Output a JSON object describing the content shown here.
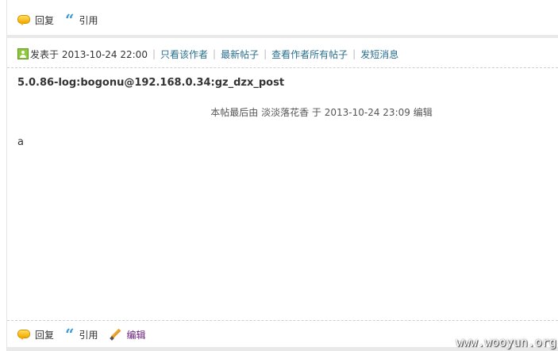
{
  "top_actions": {
    "reply": "回复",
    "quote": "引用"
  },
  "post": {
    "posted_at": "发表于 2013-10-24 22:00",
    "links": [
      "只看该作者",
      "最新帖子",
      "查看作者所有帖子",
      "发短消息"
    ],
    "title": "5.0.86-log:bogonu@192.168.0.34:gz_dzx_post",
    "edit_note": "本帖最后由 淡淡落花香 于 2013-10-24 23:09 编辑",
    "content": "a"
  },
  "bottom_actions": {
    "reply": "回复",
    "quote": "引用",
    "edit": "编辑"
  },
  "watermark": "www.wooyun.org"
}
